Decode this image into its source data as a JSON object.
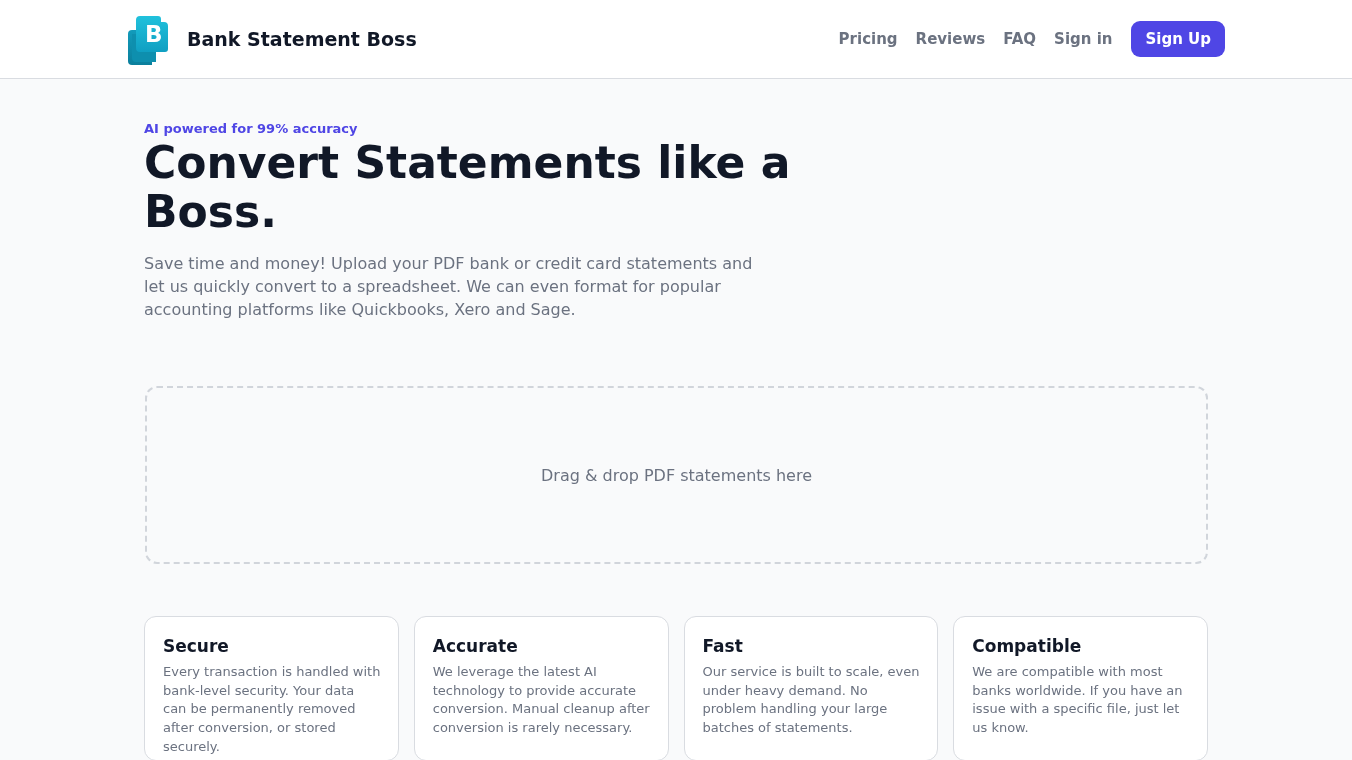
{
  "header": {
    "logo": {
      "letter": "B"
    },
    "brand": "Bank Statement Boss",
    "nav": [
      {
        "label": "Pricing",
        "kind": "link"
      },
      {
        "label": "Reviews",
        "kind": "link"
      },
      {
        "label": "FAQ",
        "kind": "link"
      },
      {
        "label": "Sign in",
        "kind": "link"
      },
      {
        "label": "Sign Up",
        "kind": "button"
      }
    ]
  },
  "hero": {
    "eyebrow": "AI powered for 99% accuracy",
    "title": "Convert Statements like a Boss.",
    "description": "Save time and money! Upload your PDF bank or credit card statements and let us quickly convert to a spreadsheet. We can even format for popular accounting platforms like Quickbooks, Xero and Sage."
  },
  "dropzone": {
    "label": "Drag & drop PDF statements here"
  },
  "features": [
    {
      "title": "Secure",
      "description": "Every transaction is handled with bank-level security. Your data can be permanently removed after conversion, or stored securely."
    },
    {
      "title": "Accurate",
      "description": "We leverage the latest AI technology to provide accurate conversion. Manual cleanup after conversion is rarely necessary."
    },
    {
      "title": "Fast",
      "description": "Our service is built to scale, even under heavy demand. No problem handling your large batches of statements."
    },
    {
      "title": "Compatible",
      "description": "We are compatible with most banks worldwide. If you have an issue with a specific file, just let us know."
    }
  ]
}
